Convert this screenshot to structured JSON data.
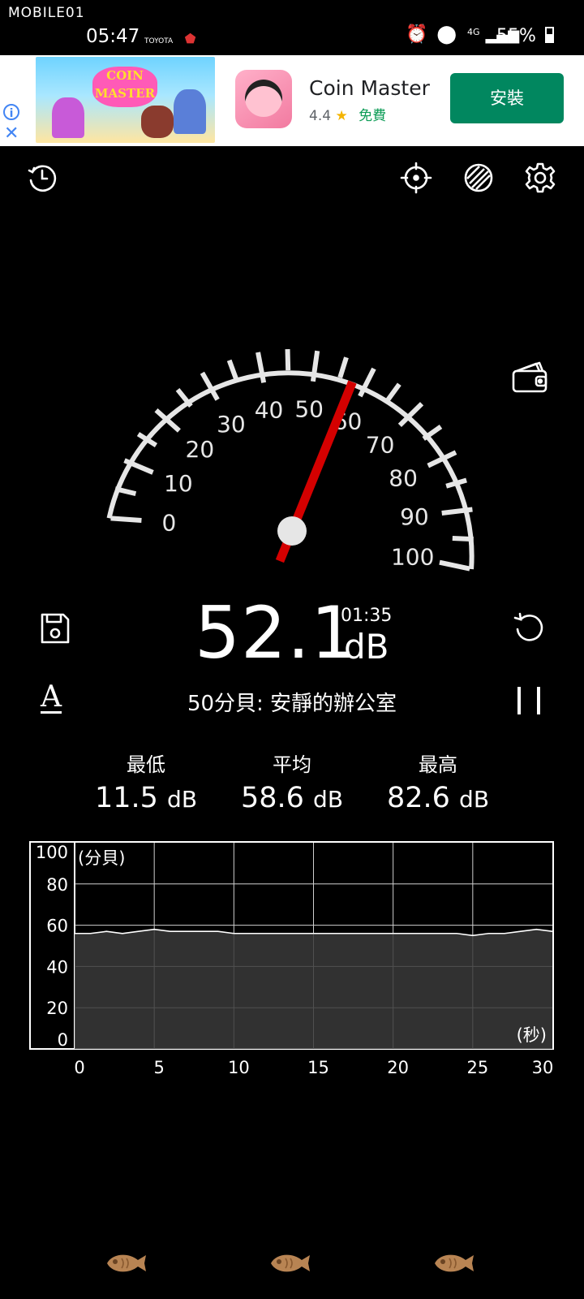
{
  "status_bar": {
    "watermark": "MOBILE01",
    "time": "05:47",
    "carrier_icons": "TOYOTA",
    "network": "4G",
    "battery": "55%"
  },
  "ad": {
    "art_logo": "COIN MASTER",
    "app_name": "Coin Master",
    "rating": "4.4",
    "price": "免費",
    "install_label": "安裝"
  },
  "toolbar": {
    "history_icon": "history-icon",
    "calibrate_icon": "crosshair-icon",
    "theme_icon": "stripes-icon",
    "settings_icon": "gear-icon"
  },
  "gauge": {
    "scale_min": 0,
    "scale_max": 100,
    "tick_labels": [
      "0",
      "10",
      "20",
      "30",
      "40",
      "50",
      "60",
      "70",
      "80",
      "90",
      "100"
    ],
    "needle_value": 57.5,
    "needle_color": "#d40000"
  },
  "reading": {
    "value": "52.1",
    "unit": "dB",
    "elapsed": "01:35",
    "description": "50分貝: 安靜的辦公室",
    "weighting": "A"
  },
  "stats": [
    {
      "label": "最低",
      "value": "11.5",
      "unit": "dB"
    },
    {
      "label": "平均",
      "value": "58.6",
      "unit": "dB"
    },
    {
      "label": "最高",
      "value": "82.6",
      "unit": "dB"
    }
  ],
  "chart_data": {
    "type": "area",
    "ylabel": "(分貝)",
    "xlabel": "(秒)",
    "yticks": [
      "100",
      "80",
      "60",
      "40",
      "20",
      "0"
    ],
    "ytick_values": [
      100,
      80,
      60,
      40,
      20,
      0
    ],
    "xticks": [
      "0",
      "5",
      "10",
      "15",
      "20",
      "25",
      "30"
    ],
    "xtick_values": [
      0,
      5,
      10,
      15,
      20,
      25,
      30
    ],
    "xlim": [
      0,
      30
    ],
    "ylim": [
      0,
      100
    ],
    "series": [
      {
        "x": [
          0,
          1,
          2,
          3,
          4,
          5,
          6,
          7,
          8,
          9,
          10,
          11,
          12,
          13,
          14,
          15,
          16,
          17,
          18,
          19,
          20,
          21,
          22,
          23,
          24,
          25,
          26,
          27,
          28,
          29,
          30
        ],
        "values": [
          56,
          56,
          57,
          56,
          57,
          58,
          57,
          57,
          57,
          57,
          56,
          56,
          56,
          56,
          56,
          56,
          56,
          56,
          56,
          56,
          56,
          56,
          56,
          56,
          56,
          55,
          56,
          56,
          57,
          58,
          57
        ]
      }
    ],
    "grid": true,
    "line_color": "#ffffff",
    "fill_color": "#3a3a3a"
  },
  "nav": {
    "items": [
      "fish-icon",
      "fish-icon",
      "fish-icon"
    ]
  }
}
